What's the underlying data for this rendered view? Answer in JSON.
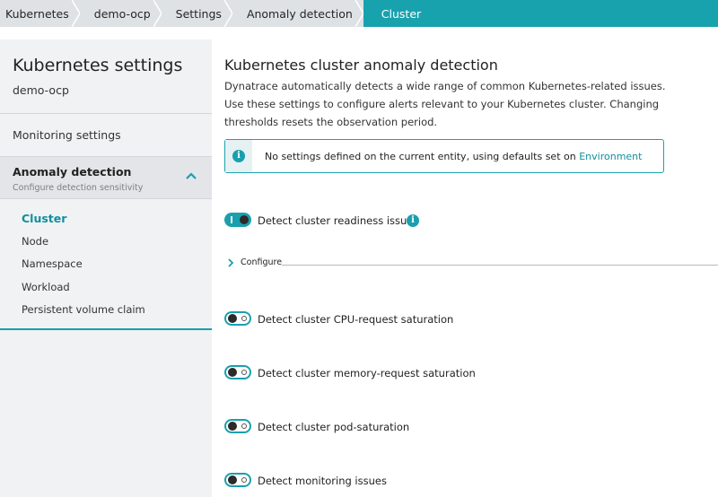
{
  "breadcrumb": {
    "items": [
      "Kubernetes",
      "demo-ocp",
      "Settings",
      "Anomaly detection"
    ],
    "current": "Cluster"
  },
  "sidebar": {
    "title": "Kubernetes settings",
    "subtitle": "demo-ocp",
    "monitoring_label": "Monitoring settings",
    "section": {
      "title": "Anomaly detection",
      "subtitle": "Configure detection sensitivity"
    },
    "items": [
      {
        "label": "Cluster",
        "active": true
      },
      {
        "label": "Node",
        "active": false
      },
      {
        "label": "Namespace",
        "active": false
      },
      {
        "label": "Workload",
        "active": false
      },
      {
        "label": "Persistent volume claim",
        "active": false
      }
    ]
  },
  "main": {
    "title": "Kubernetes cluster anomaly detection",
    "description": "Dynatrace automatically detects a wide range of common Kubernetes-related issues. Use these settings to configure alerts relevant to your Kubernetes cluster. Changing thresholds resets the observation period.",
    "info": {
      "text": "No settings defined on the current entity, using defaults set on ",
      "link": "Environment",
      "icon": "info-icon"
    },
    "configure_label": "Configure",
    "toggles": [
      {
        "label": "Detect cluster readiness issues",
        "on": true,
        "has_info": true
      },
      {
        "label": "Detect cluster CPU-request saturation",
        "on": false,
        "has_info": false
      },
      {
        "label": "Detect cluster memory-request saturation",
        "on": false,
        "has_info": false
      },
      {
        "label": "Detect cluster pod-saturation",
        "on": false,
        "has_info": false
      },
      {
        "label": "Detect monitoring issues",
        "on": false,
        "has_info": false
      }
    ],
    "info_glyph": "i"
  },
  "colors": {
    "accent": "#1a9fad",
    "breadcrumb_bg": "#dfe2e5",
    "sidebar_bg": "#f1f2f3"
  }
}
